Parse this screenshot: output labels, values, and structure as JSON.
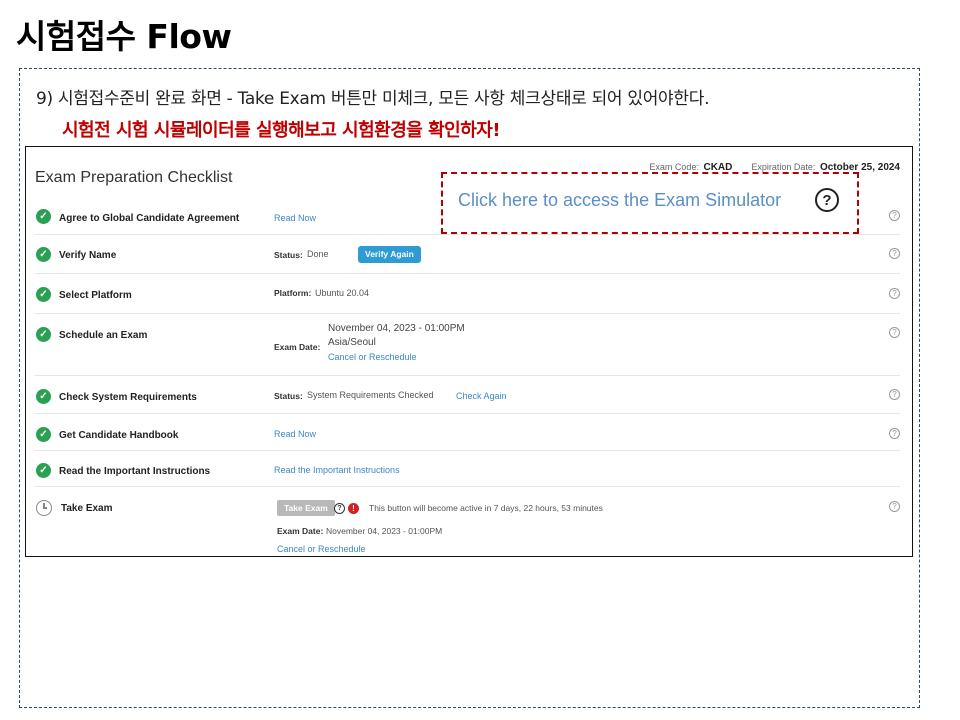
{
  "slide": {
    "title": "시험접수 Flow",
    "description": "9) 시험접수준비 완료 화면 - Take Exam 버튼만 미체크, 모든 사항 체크상태로 되어 있어야한다.",
    "highlight": "시험전 시험 시뮬레이터를 실행해보고 시험환경을 확인하자!"
  },
  "checklist": {
    "title": "Exam Preparation Checklist",
    "exam_code_label": "Exam Code:",
    "exam_code": "CKAD",
    "expiration_label": "Expiration Date:",
    "expiration_date": "October 25, 2024",
    "simulator_link": "Click here to access the Exam Simulator",
    "help_glyph": "?",
    "check_glyph": "✓",
    "items": [
      {
        "label": "Agree to Global Candidate Agreement",
        "link": "Read Now",
        "done": true
      },
      {
        "label": "Verify Name",
        "status_label": "Status:",
        "status_value": "Done",
        "button": "Verify Again",
        "done": true
      },
      {
        "label": "Select Platform",
        "field_label": "Platform:",
        "field_value": "Ubuntu 20.04",
        "done": true
      },
      {
        "label": "Schedule an Exam",
        "field_label": "Exam Date:",
        "date_line": "November 04, 2023 - 01:00PM",
        "timezone": "Asia/Seoul",
        "link": "Cancel or Reschedule",
        "done": true
      },
      {
        "label": "Check System Requirements",
        "status_label": "Status:",
        "status_value": "System Requirements Checked",
        "link": "Check Again",
        "done": true
      },
      {
        "label": "Get Candidate Handbook",
        "link": "Read Now",
        "done": true
      },
      {
        "label": "Read the Important Instructions",
        "link": "Read the Important Instructions",
        "done": true
      },
      {
        "label": "Take Exam",
        "button": "Take Exam",
        "notice": "This button will become active in 7 days, 22 hours, 53 minutes",
        "field_label": "Exam Date:",
        "field_value": "November 04, 2023 - 01:00PM",
        "link": "Cancel or Reschedule",
        "warn_glyph": "!",
        "done": false
      }
    ]
  },
  "colors": {
    "highlight": "#c00000",
    "check_green": "#2aa152",
    "link_blue": "#3b88c5",
    "button_blue": "#2f9bd3",
    "simulator_text": "#5a8fc6",
    "dashed_red": "#b00000"
  },
  "icons": {
    "check": "check-circle-icon",
    "clock": "clock-icon",
    "help": "help-circle-icon",
    "warning": "warning-icon"
  }
}
